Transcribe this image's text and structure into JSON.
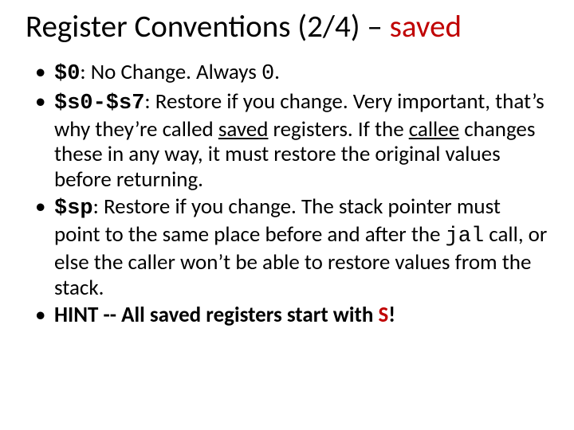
{
  "title": {
    "main": "Register Conventions (2/4) – ",
    "saved_word": "saved"
  },
  "bullets": {
    "b0": {
      "reg": "$0",
      "colon": ": ",
      "text_a": "No Change.  Always ",
      "zero": "0",
      "period": "."
    },
    "b1": {
      "reg": "$s0-$s7",
      "colon": ": ",
      "text_a": "Restore if you change. Very important, that’s why they’re called ",
      "saved": "saved",
      "text_b": " registers.  If the ",
      "callee": "callee",
      "text_c": " changes these in any way, it must restore the original values before returning."
    },
    "b2": {
      "reg": "$sp",
      "colon": ": ",
      "text_a": "Restore if you change. The stack pointer must point to the same place before and after the ",
      "jal": "jal",
      "text_b": " call, or else the caller won’t be able to restore values from the stack."
    },
    "b3": {
      "hint": "HINT -- All saved registers start with ",
      "s": "S",
      "excl": "!"
    }
  }
}
